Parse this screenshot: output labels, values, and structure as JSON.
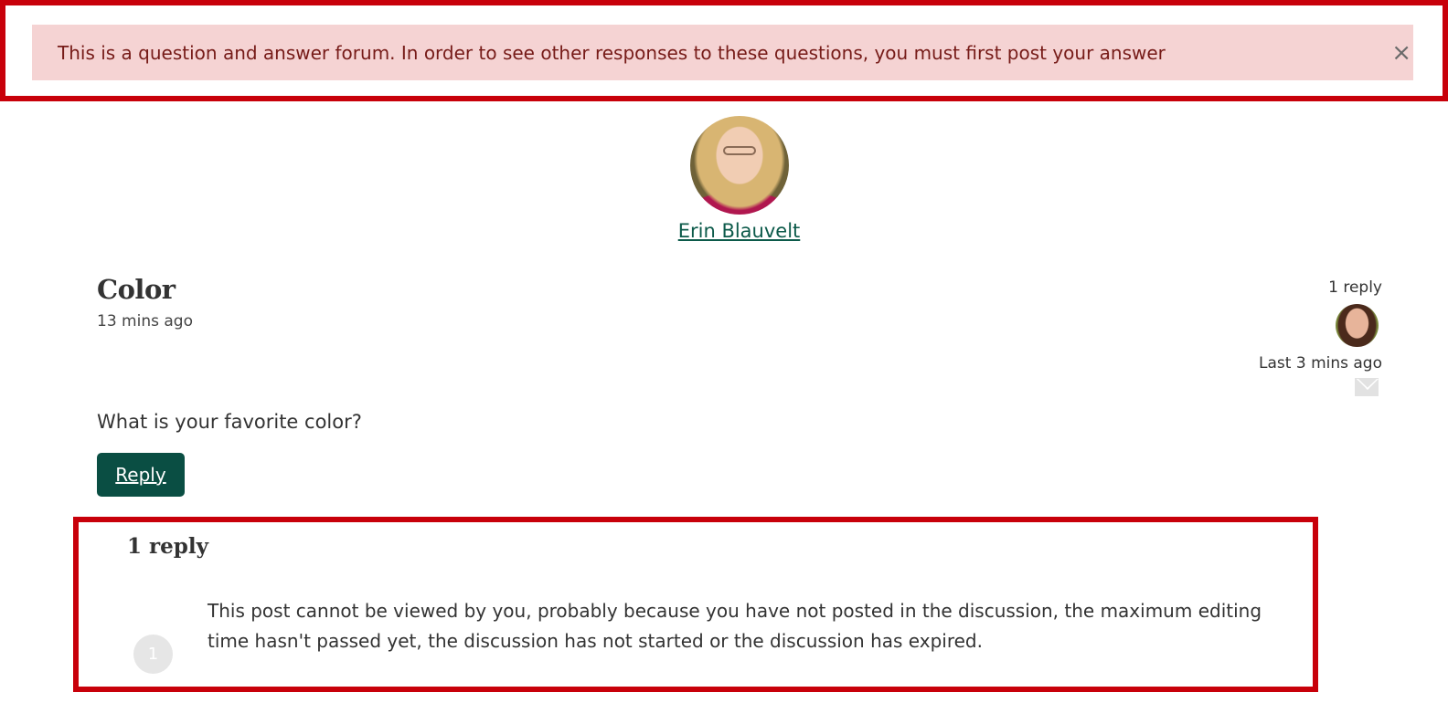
{
  "alert": {
    "message": "This is a question and answer forum. In order to see other responses to these questions, you must first post your answer",
    "close_glyph": "×"
  },
  "author": {
    "name": "Erin Blauvelt"
  },
  "post": {
    "title": "Color",
    "time": "13 mins ago",
    "body": "What is your favorite color?",
    "reply_label": "Reply"
  },
  "meta": {
    "reply_count": "1 reply",
    "last_activity": "Last 3 mins ago"
  },
  "replies": {
    "heading": "1 reply",
    "items": [
      {
        "number": "1",
        "text": "This post cannot be viewed by you, probably because you have not posted in the discussion, the maximum editing time hasn't passed yet, the discussion has not started or the discussion has expired."
      }
    ]
  },
  "colors": {
    "alert_background": "#f5d3d3",
    "alert_text": "#761b18",
    "highlight_outline": "#c8000a",
    "primary_button": "#0a4e43",
    "link": "#0c5a4a"
  }
}
